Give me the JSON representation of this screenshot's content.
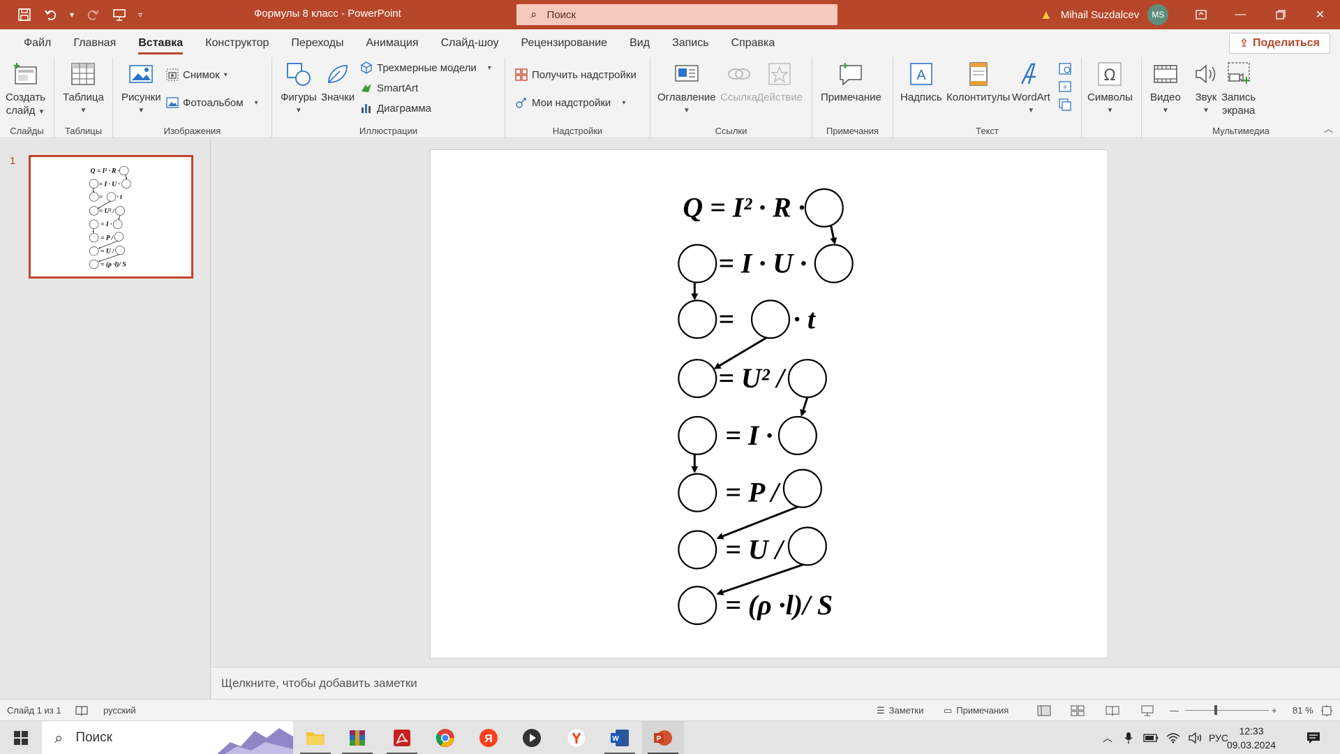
{
  "window": {
    "title": "Формулы 8 класс  -  PowerPoint",
    "search_placeholder": "Поиск",
    "user_name": "Mihail Suzdalcev",
    "user_initials": "MS"
  },
  "tabs": [
    {
      "label": "Файл"
    },
    {
      "label": "Главная"
    },
    {
      "label": "Вставка"
    },
    {
      "label": "Конструктор"
    },
    {
      "label": "Переходы"
    },
    {
      "label": "Анимация"
    },
    {
      "label": "Слайд-шоу"
    },
    {
      "label": "Рецензирование"
    },
    {
      "label": "Вид"
    },
    {
      "label": "Запись"
    },
    {
      "label": "Справка"
    }
  ],
  "active_tab": "Вставка",
  "share_label": "Поделиться",
  "ribbon": {
    "slides": {
      "label": "Слайды",
      "new_slide_1": "Создать",
      "new_slide_2": "слайд"
    },
    "tables": {
      "label": "Таблицы",
      "table": "Таблица"
    },
    "images": {
      "label": "Изображения",
      "pictures": "Рисунки",
      "screenshot": "Снимок",
      "album": "Фотоальбом"
    },
    "illustrations": {
      "label": "Иллюстрации",
      "shapes": "Фигуры",
      "icons": "Значки",
      "models3d": "Трехмерные модели",
      "smartart": "SmartArt",
      "chart": "Диаграмма"
    },
    "addins": {
      "label": "Надстройки",
      "get": "Получить надстройки",
      "my": "Мои надстройки"
    },
    "links": {
      "label": "Ссылки",
      "toc": "Оглавление",
      "link": "Ссылка",
      "action": "Действие"
    },
    "comments": {
      "label": "Примечания",
      "comment": "Примечание"
    },
    "text": {
      "label": "Текст",
      "textbox": "Надпись",
      "headerfooter": "Колонтитулы",
      "wordart": "WordArt"
    },
    "symbols": {
      "label": "Символы"
    },
    "media": {
      "label": "Мультимедиа",
      "video": "Видео",
      "audio": "Звук",
      "rec1": "Запись",
      "rec2": "экрана"
    }
  },
  "thumbnail": {
    "number": "1"
  },
  "slide": {
    "equations": [
      {
        "text": "Q = I² · R ·"
      },
      {
        "text": "= I · U ·"
      },
      {
        "text": "= "
      },
      {
        "text": "· t"
      },
      {
        "text": "= U² /"
      },
      {
        "text": "= I ·"
      },
      {
        "text": "= P /"
      },
      {
        "text": "= U /"
      },
      {
        "text": "= (ρ  ·l)/ S"
      }
    ]
  },
  "notes_placeholder": "Щелкните, чтобы добавить заметки",
  "status": {
    "slide_counter": "Слайд 1 из 1",
    "language": "русский",
    "notes": "Заметки",
    "comments": "Примечания",
    "zoom": "81 %"
  },
  "taskbar": {
    "search": "Поиск",
    "lang": "РУС",
    "time": "12:33",
    "date": "09.03.2024"
  },
  "colors": {
    "accent": "#b7472a",
    "titlebar": "#b7472a",
    "search_bg": "#f6c9bd"
  }
}
